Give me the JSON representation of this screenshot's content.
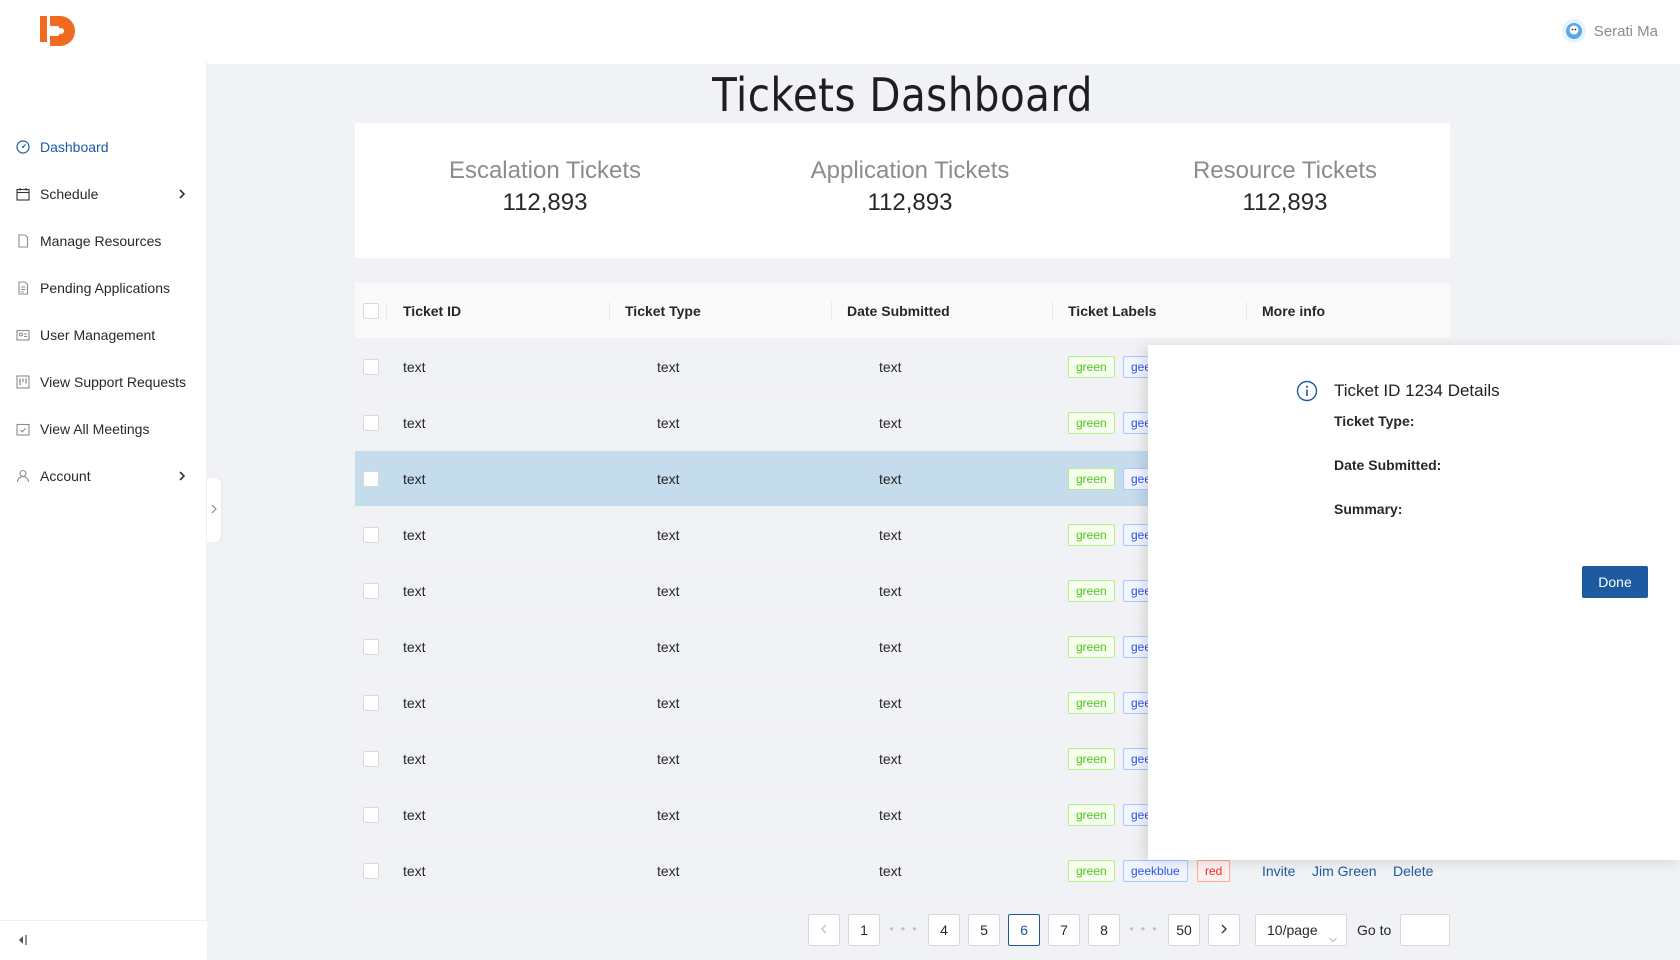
{
  "header": {
    "user_name": "Serati Ma"
  },
  "sidebar": {
    "items": [
      {
        "label": "Dashboard",
        "icon": "dashboard-icon",
        "active": true,
        "has_arrow": false
      },
      {
        "label": "Schedule",
        "icon": "calendar-icon",
        "active": false,
        "has_arrow": true
      },
      {
        "label": "Manage Resources",
        "icon": "file-icon",
        "active": false,
        "has_arrow": false
      },
      {
        "label": "Pending Applications",
        "icon": "file-text-icon",
        "active": false,
        "has_arrow": false
      },
      {
        "label": "User Management",
        "icon": "id-card-icon",
        "active": false,
        "has_arrow": false
      },
      {
        "label": "View Support Requests",
        "icon": "project-icon",
        "active": false,
        "has_arrow": false
      },
      {
        "label": "View All Meetings",
        "icon": "carry-out-icon",
        "active": false,
        "has_arrow": false
      },
      {
        "label": "Account",
        "icon": "user-icon",
        "active": false,
        "has_arrow": true
      }
    ]
  },
  "page": {
    "title": "Tickets Dashboard"
  },
  "stats": [
    {
      "label": "Escalation Tickets",
      "value": "112,893"
    },
    {
      "label": "Application Tickets",
      "value": "112,893"
    },
    {
      "label": "Resource Tickets",
      "value": "112,893"
    }
  ],
  "table": {
    "columns": [
      "Ticket ID",
      "Ticket Type",
      "Date Submitted",
      "Ticket Labels",
      "More info"
    ],
    "rows": [
      {
        "id": "text",
        "type": "text",
        "date": "text",
        "tags": [
          "green",
          "geekblue"
        ],
        "selected": false
      },
      {
        "id": "text",
        "type": "text",
        "date": "text",
        "tags": [
          "green",
          "geekblue"
        ],
        "selected": false
      },
      {
        "id": "text",
        "type": "text",
        "date": "text",
        "tags": [
          "green",
          "geekblue"
        ],
        "selected": true
      },
      {
        "id": "text",
        "type": "text",
        "date": "text",
        "tags": [
          "green",
          "geekblue"
        ],
        "selected": false
      },
      {
        "id": "text",
        "type": "text",
        "date": "text",
        "tags": [
          "green",
          "geekblue"
        ],
        "selected": false
      },
      {
        "id": "text",
        "type": "text",
        "date": "text",
        "tags": [
          "green",
          "geekblue"
        ],
        "selected": false
      },
      {
        "id": "text",
        "type": "text",
        "date": "text",
        "tags": [
          "green",
          "geekblue"
        ],
        "selected": false
      },
      {
        "id": "text",
        "type": "text",
        "date": "text",
        "tags": [
          "green",
          "geekblue"
        ],
        "selected": false
      },
      {
        "id": "text",
        "type": "text",
        "date": "text",
        "tags": [
          "green",
          "geekblue"
        ],
        "selected": false
      },
      {
        "id": "text",
        "type": "text",
        "date": "text",
        "tags": [
          "green",
          "geekblue",
          "red"
        ],
        "selected": false
      }
    ],
    "actions": [
      "Invite",
      "Jim Green",
      "Delete"
    ]
  },
  "pagination": {
    "pages": [
      "1",
      "4",
      "5",
      "6",
      "7",
      "8",
      "50"
    ],
    "current": "6",
    "ellipsis": "• • •",
    "page_size": "10/page",
    "goto_label": "Go to",
    "goto_value": ""
  },
  "drawer": {
    "title": "Ticket ID 1234 Details",
    "fields": [
      "Ticket Type:",
      "Date Submitted:",
      "Summary:"
    ],
    "done_label": "Done"
  },
  "colors": {
    "accent": "#1d5aa0",
    "selected_row": "#c5dcec",
    "logo_orange": "#f26a21",
    "tag_green": "#52c41a",
    "tag_blue": "#2f54eb",
    "tag_red": "#f5222d"
  }
}
